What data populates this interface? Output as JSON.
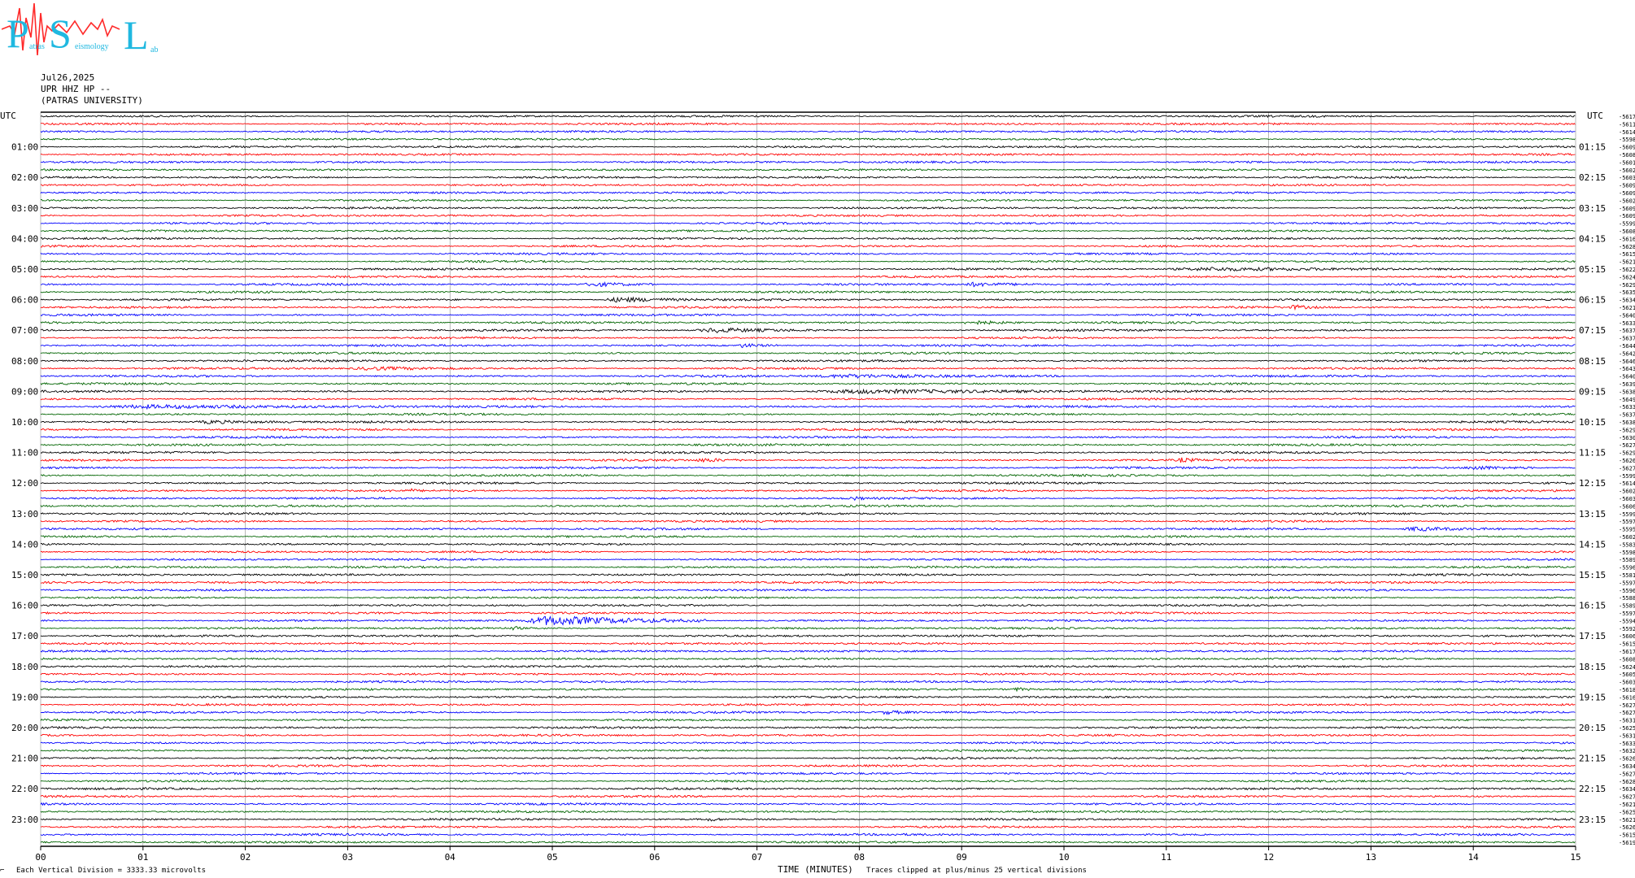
{
  "logo": {
    "letters": [
      "P",
      "S",
      "L"
    ],
    "small_text": [
      "atras",
      "eismology",
      "ab"
    ],
    "colors": {
      "letters": "#1fb8e0",
      "wave": "#ff2a2a"
    }
  },
  "header": {
    "date": "Jul26,2025",
    "station": "UPR HHZ HP --",
    "org": "(PATRAS UNIVERSITY)"
  },
  "footer": {
    "left_note": "Each Vertical Division = 3333.33 microvolts",
    "xlabel": "TIME (MINUTES)",
    "clip_note": "Traces clipped at plus/minus 25 vertical divisions"
  },
  "chart_data": {
    "type": "line",
    "xlabel": "TIME (MINUTES)",
    "xlim": [
      0,
      15
    ],
    "x_ticks": [
      "00",
      "01",
      "02",
      "03",
      "04",
      "05",
      "06",
      "07",
      "08",
      "09",
      "10",
      "11",
      "12",
      "13",
      "14",
      "15"
    ],
    "left_axis_label": "UTC",
    "right_axis_label": "UTC",
    "left_hour_labels": [
      "01:00",
      "02:00",
      "03:00",
      "04:00",
      "05:00",
      "06:00",
      "07:00",
      "08:00",
      "09:00",
      "10:00",
      "11:00",
      "12:00",
      "13:00",
      "14:00",
      "15:00",
      "16:00",
      "17:00",
      "18:00",
      "19:00",
      "20:00",
      "21:00",
      "22:00",
      "23:00"
    ],
    "right_hour_labels": [
      "01:15",
      "02:15",
      "03:15",
      "04:15",
      "05:15",
      "06:15",
      "07:15",
      "08:15",
      "09:15",
      "10:15",
      "11:15",
      "12:15",
      "13:15",
      "14:15",
      "15:15",
      "16:15",
      "17:15",
      "18:15",
      "19:15",
      "20:15",
      "21:15",
      "22:15",
      "23:15"
    ],
    "trace_colors": [
      "#000000",
      "#ff0000",
      "#0000ff",
      "#006400"
    ],
    "trace_count": 96,
    "trace_offsets": [
      "-5617",
      "-5611",
      "-5614",
      "-5598",
      "-5609",
      "-5608",
      "-5601",
      "-5602",
      "-5603",
      "-5609",
      "-5609",
      "-5602",
      "-5609",
      "-5609",
      "-5599",
      "-5608",
      "-5616",
      "-5628",
      "-5615",
      "-5621",
      "-5622",
      "-5624",
      "-5629",
      "-5635",
      "-5634",
      "-5621",
      "-5640",
      "-5633",
      "-5637",
      "-5637",
      "-5644",
      "-5642",
      "-5646",
      "-5643",
      "-5640",
      "-5639",
      "-5638",
      "-5649",
      "-5633",
      "-5637",
      "-5638",
      "-5629",
      "-5630",
      "-5627",
      "-5629",
      "-5626",
      "-5627",
      "-5599",
      "-5614",
      "-5602",
      "-5603",
      "-5606",
      "-5599",
      "-5597",
      "-5595",
      "-5602",
      "-5583",
      "-5598",
      "-5589",
      "-5596",
      "-5581",
      "-5597",
      "-5596",
      "-5588",
      "-5589",
      "-5597",
      "-5594",
      "-5592",
      "-5606",
      "-5615",
      "-5617",
      "-5608",
      "-5624",
      "-5605",
      "-5603",
      "-5618",
      "-5616",
      "-5627",
      "-5627",
      "-5631",
      "-5625",
      "-5631",
      "-5633",
      "-5632",
      "-5626",
      "-5634",
      "-5627",
      "-5628",
      "-5634",
      "-5627",
      "-5621",
      "-5625",
      "-5621",
      "-5626",
      "-5615",
      "-5619"
    ],
    "events": [
      {
        "trace": 20,
        "start_min": 11.0,
        "end_min": 14.0,
        "amplitude": 1.6
      },
      {
        "trace": 22,
        "start_min": 5.3,
        "end_min": 6.0,
        "amplitude": 2.2
      },
      {
        "trace": 22,
        "start_min": 9.0,
        "end_min": 9.8,
        "amplitude": 2.0
      },
      {
        "trace": 24,
        "start_min": 5.5,
        "end_min": 6.5,
        "amplitude": 2.6
      },
      {
        "trace": 25,
        "start_min": 12.2,
        "end_min": 12.5,
        "amplitude": 2.5
      },
      {
        "trace": 27,
        "start_min": 9.0,
        "end_min": 9.6,
        "amplitude": 2.0
      },
      {
        "trace": 28,
        "start_min": 6.4,
        "end_min": 7.6,
        "amplitude": 2.4
      },
      {
        "trace": 30,
        "start_min": 6.8,
        "end_min": 7.2,
        "amplitude": 2.0
      },
      {
        "trace": 33,
        "start_min": 3.0,
        "end_min": 4.5,
        "amplitude": 1.6
      },
      {
        "trace": 34,
        "start_min": 7.5,
        "end_min": 10.0,
        "amplitude": 1.8
      },
      {
        "trace": 36,
        "start_min": 7.5,
        "end_min": 11.0,
        "amplitude": 2.0
      },
      {
        "trace": 38,
        "start_min": 0.5,
        "end_min": 4.0,
        "amplitude": 1.8
      },
      {
        "trace": 40,
        "start_min": 1.5,
        "end_min": 2.5,
        "amplitude": 1.6
      },
      {
        "trace": 45,
        "start_min": 6.4,
        "end_min": 6.9,
        "amplitude": 2.0
      },
      {
        "trace": 45,
        "start_min": 11.1,
        "end_min": 11.4,
        "amplitude": 2.6
      },
      {
        "trace": 46,
        "start_min": 13.9,
        "end_min": 14.6,
        "amplitude": 2.0
      },
      {
        "trace": 49,
        "start_min": 3.6,
        "end_min": 3.7,
        "amplitude": 2.2
      },
      {
        "trace": 50,
        "start_min": 7.9,
        "end_min": 8.1,
        "amplitude": 2.4
      },
      {
        "trace": 54,
        "start_min": 13.3,
        "end_min": 14.3,
        "amplitude": 2.0
      },
      {
        "trace": 66,
        "start_min": 4.7,
        "end_min": 6.5,
        "amplitude": 5.5
      },
      {
        "trace": 67,
        "start_min": 4.6,
        "end_min": 4.7,
        "amplitude": 3.0
      },
      {
        "trace": 75,
        "start_min": 9.5,
        "end_min": 9.7,
        "amplitude": 2.0
      },
      {
        "trace": 78,
        "start_min": 8.2,
        "end_min": 8.6,
        "amplitude": 2.0
      },
      {
        "trace": 92,
        "start_min": 6.5,
        "end_min": 6.7,
        "amplitude": 2.0
      }
    ]
  }
}
